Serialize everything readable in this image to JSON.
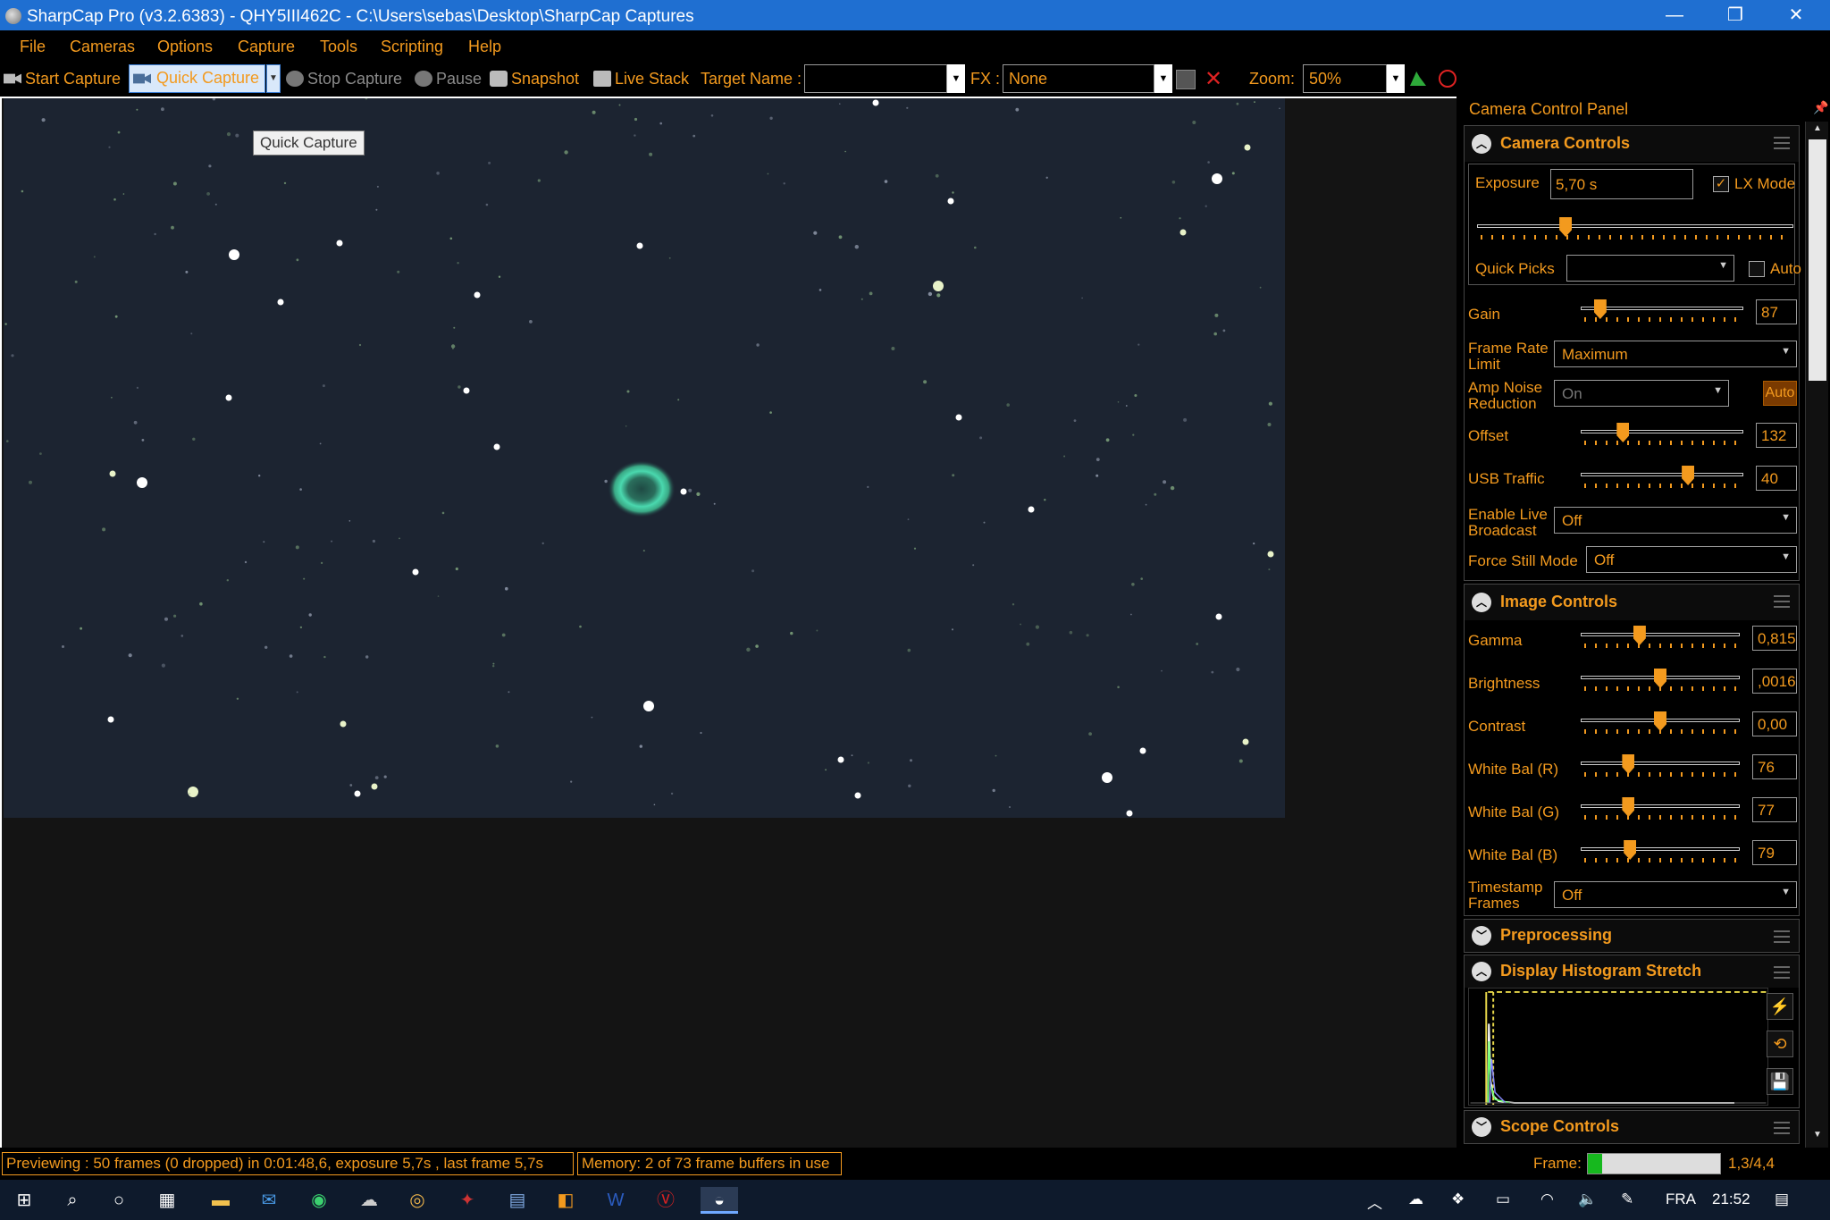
{
  "window": {
    "title": "SharpCap Pro (v3.2.6383) - QHY5III462C - C:\\Users\\sebas\\Desktop\\SharpCap Captures",
    "min": "—",
    "max": "❐",
    "close": "✕"
  },
  "menu": [
    "File",
    "Cameras",
    "Options",
    "Capture",
    "Tools",
    "Scripting",
    "Help"
  ],
  "toolbar": {
    "start_capture": "Start Capture",
    "quick_capture": "Quick Capture",
    "stop_capture": "Stop Capture",
    "pause": "Pause",
    "snapshot": "Snapshot",
    "live_stack": "Live Stack",
    "target_name_label": "Target Name :",
    "target_name_value": "",
    "fx_label": "FX :",
    "fx_value": "None",
    "zoom_label": "Zoom:",
    "zoom_value": "50%"
  },
  "tooltip": "Quick Capture",
  "panel": {
    "title": "Camera Control Panel",
    "camera_controls": {
      "title": "Camera Controls",
      "exposure_label": "Exposure",
      "exposure_value": "5,70 s",
      "lx_mode_label": "LX Mode",
      "lx_mode_checked": true,
      "exposure_slider": 0.28,
      "quick_picks_label": "Quick Picks",
      "quick_picks_value": "",
      "auto_label": "Auto",
      "gain_label": "Gain",
      "gain_value": "87",
      "gain_slider": 0.12,
      "frame_rate_label_1": "Frame Rate",
      "frame_rate_label_2": "Limit",
      "frame_rate_value": "Maximum",
      "amp_noise_label_1": "Amp Noise",
      "amp_noise_label_2": "Reduction",
      "amp_noise_value": "On",
      "amp_noise_auto": "Auto",
      "offset_label": "Offset",
      "offset_value": "132",
      "offset_slider": 0.26,
      "usb_label": "USB Traffic",
      "usb_value": "40",
      "usb_slider": 0.66,
      "live_broadcast_label_1": "Enable Live",
      "live_broadcast_label_2": "Broadcast",
      "live_broadcast_value": "Off",
      "force_still_label": "Force Still Mode",
      "force_still_value": "Off"
    },
    "image_controls": {
      "title": "Image Controls",
      "rows": [
        {
          "label": "Gamma",
          "value": "0,815",
          "slider": 0.37
        },
        {
          "label": "Brightness",
          "value": ",0016",
          "slider": 0.5
        },
        {
          "label": "Contrast",
          "value": "0,00",
          "slider": 0.5
        },
        {
          "label": "White Bal (R)",
          "value": "76",
          "slider": 0.3
        },
        {
          "label": "White Bal (G)",
          "value": "77",
          "slider": 0.3
        },
        {
          "label": "White Bal (B)",
          "value": "79",
          "slider": 0.31
        }
      ],
      "timestamp_label_1": "Timestamp",
      "timestamp_label_2": "Frames",
      "timestamp_value": "Off"
    },
    "preprocessing": {
      "title": "Preprocessing"
    },
    "histogram": {
      "title": "Display Histogram Stretch"
    },
    "scope_controls": {
      "title": "Scope Controls"
    }
  },
  "status": {
    "previewing": "Previewing : 50 frames (0 dropped) in 0:01:48,6, exposure 5,7s , last frame 5,7s",
    "memory": "Memory: 2 of 73 frame buffers in use",
    "frame_label": "Frame:",
    "frame_progress": 0.11,
    "frame_value": "1,3/4,4"
  },
  "taskbar": {
    "language": "FRA",
    "time": "21:52"
  },
  "colors": {
    "accent": "#f39a1e",
    "titlebar": "#1f6fd1",
    "sky": "#1c2431",
    "nebula": "#3fd3a8"
  }
}
